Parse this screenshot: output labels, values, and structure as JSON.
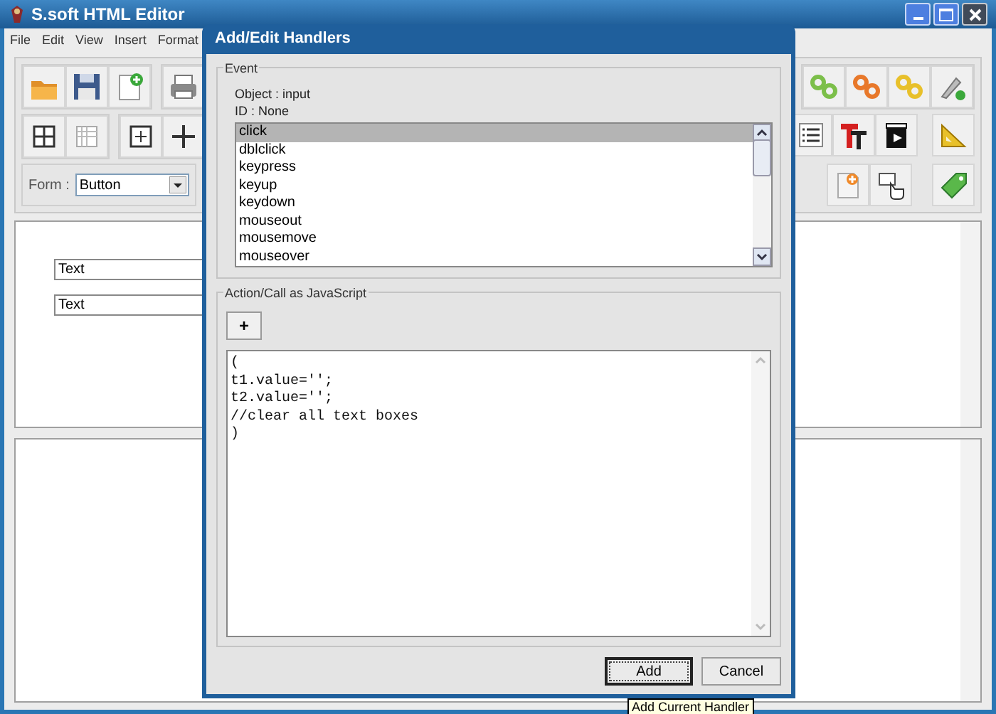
{
  "window": {
    "title": "S.soft HTML Editor"
  },
  "menu": [
    "File",
    "Edit",
    "View",
    "Insert",
    "Format"
  ],
  "form_bar": {
    "label": "Form :",
    "select_value": "Button"
  },
  "editor_fields": [
    {
      "value": "Text"
    },
    {
      "value": "Text"
    }
  ],
  "dialog": {
    "title": "Add/Edit Handlers",
    "event_group": {
      "title": "Event",
      "object_line": "Object : input",
      "id_line": "ID : None",
      "events": [
        {
          "label": "click",
          "selected": true
        },
        {
          "label": "dblclick",
          "selected": false
        },
        {
          "label": "keypress",
          "selected": false
        },
        {
          "label": "keyup",
          "selected": false
        },
        {
          "label": "keydown",
          "selected": false
        },
        {
          "label": "mouseout",
          "selected": false
        },
        {
          "label": "mousemove",
          "selected": false
        },
        {
          "label": "mouseover",
          "selected": false
        }
      ]
    },
    "action_group": {
      "title": "Action/Call as JavaScript",
      "add_button": "+",
      "code_lines": [
        "(",
        "t1.value='';",
        "t2.value='';",
        "//clear all text boxes",
        ")"
      ]
    },
    "buttons": [
      {
        "label": "Add",
        "default": true
      },
      {
        "label": "Cancel",
        "default": false
      }
    ]
  },
  "tooltip": "Add Current Handler"
}
